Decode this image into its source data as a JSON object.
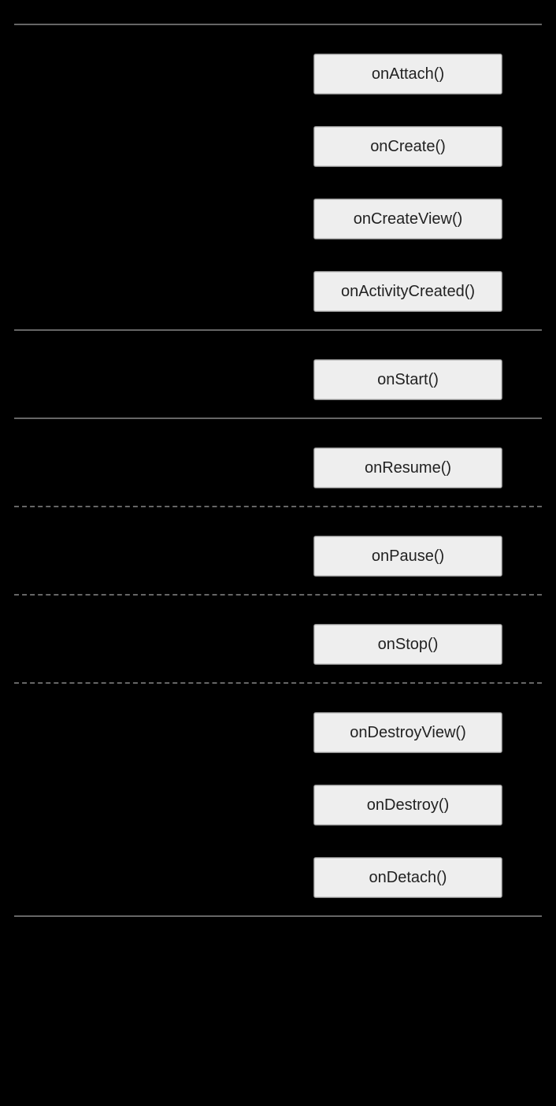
{
  "lifecycle": {
    "sections": [
      {
        "divider": "solid",
        "items": [
          "onAttach()",
          "onCreate()",
          "onCreateView()",
          "onActivityCreated()"
        ]
      },
      {
        "divider": "solid",
        "items": [
          "onStart()"
        ]
      },
      {
        "divider": "solid",
        "items": [
          "onResume()"
        ]
      },
      {
        "divider": "dashed",
        "items": [
          "onPause()"
        ]
      },
      {
        "divider": "dashed",
        "items": [
          "onStop()"
        ]
      },
      {
        "divider": "dashed",
        "items": [
          "onDestroyView()",
          "onDestroy()",
          "onDetach()"
        ]
      }
    ],
    "closing_divider": "solid"
  }
}
